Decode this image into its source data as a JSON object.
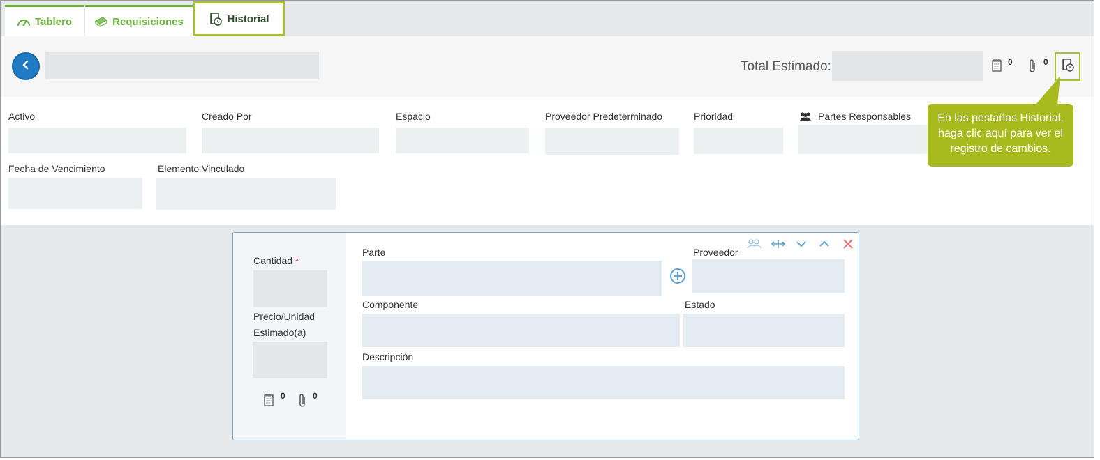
{
  "tabs": [
    {
      "label": "Tablero",
      "icon": "dashboard-gauge-icon"
    },
    {
      "label": "Requisiciones",
      "icon": "requisitions-cash-icon"
    },
    {
      "label": "Historial",
      "icon": "history-notebook-icon",
      "active": true
    }
  ],
  "header": {
    "total_label": "Total Estimado:",
    "notes_count": "0",
    "attachments_count": "0"
  },
  "form": {
    "fields": [
      {
        "label": "Activo"
      },
      {
        "label": "Creado Por"
      },
      {
        "label": "Espacio"
      },
      {
        "label": "Proveedor Predeterminado"
      },
      {
        "label": "Prioridad"
      },
      {
        "label": "Partes Responsables"
      },
      {
        "label": "Fecha de Vencimiento"
      },
      {
        "label": "Elemento Vinculado"
      }
    ]
  },
  "tooltip": {
    "text": "En las pestañas Historial, haga clic aquí para ver el registro de cambios."
  },
  "card": {
    "quantity_label": "Cantidad",
    "required_mark": "*",
    "price_label_1": "Precio/Unidad",
    "price_label_2": "Estimado(a)",
    "notes_count": "0",
    "attachments_count": "0",
    "part_label": "Parte",
    "supplier_label": "Proveedor",
    "component_label": "Componente",
    "status_label": "Estado",
    "description_label": "Descripción"
  },
  "colors": {
    "tab_green": "#6cb33f",
    "highlight": "#a9c130",
    "tooltip_bg": "#a9ba1e",
    "primary_blue": "#1e7bc4",
    "close_red": "#e57373"
  }
}
